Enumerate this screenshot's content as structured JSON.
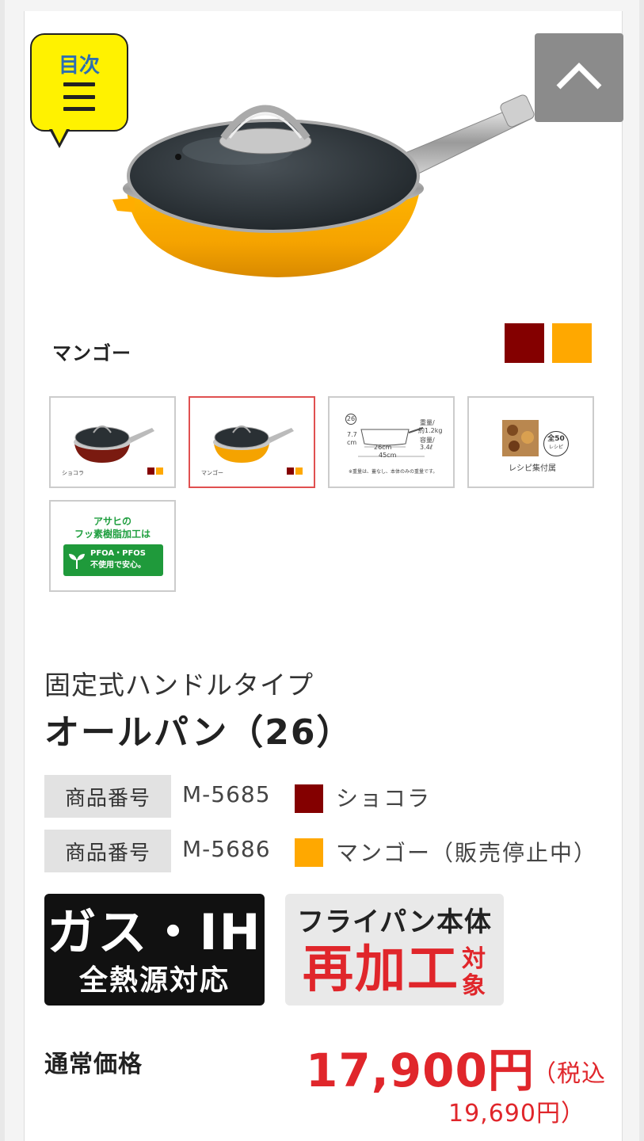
{
  "toc": {
    "label": "目次",
    "icon": "menu-icon"
  },
  "scroll_top": {
    "icon": "chevron-up-icon"
  },
  "product_image": {
    "alt": ""
  },
  "color": {
    "selected_name": "マンゴー",
    "swatches": [
      {
        "name": "ショコラ",
        "color": "#840000"
      },
      {
        "name": "マンゴー",
        "color": "#ffa800"
      }
    ]
  },
  "thumbnails": [
    {
      "caption": "ショコラ"
    },
    {
      "caption": "マンゴー"
    },
    {
      "size_no": "26",
      "height": "7.7",
      "height_unit": "cm",
      "width_top": "26cm",
      "width_bottom": "45cm",
      "weight_line1": "重量/",
      "weight_line2": "約1.2kg",
      "cap_line1": "容量/",
      "cap_line2": "3.4ℓ",
      "note": "※重量は、蓋なし、本体のみの重量です。"
    },
    {
      "badge_top": "全50",
      "badge_bottom": "レシピ",
      "caption": "レシピ集付属"
    },
    {
      "line1": "アサヒの",
      "line2": "フッ素樹脂加工は",
      "line3": "PFOA・PFOS",
      "line4": "不使用で安心。"
    }
  ],
  "product": {
    "subtitle": "固定式ハンドルタイプ",
    "title": "オールパン（26）"
  },
  "specs": [
    {
      "label": "商品番号",
      "code": "M-5685",
      "color": "#840000",
      "name": "ショコラ"
    },
    {
      "label": "商品番号",
      "code": "M-5686",
      "color": "#ffa800",
      "name": "マンゴー（販売停止中）"
    }
  ],
  "badges": {
    "gas_line1": "ガス・IH",
    "gas_line2": "全熱源対応",
    "reprocess_line1": "フライパン本体",
    "reprocess_line2": "再加工",
    "reprocess_line3": "対象"
  },
  "price": {
    "label": "通常価格",
    "amount": "17,900円",
    "tax_line1": "（税込",
    "tax_line2": "19,690円）"
  }
}
